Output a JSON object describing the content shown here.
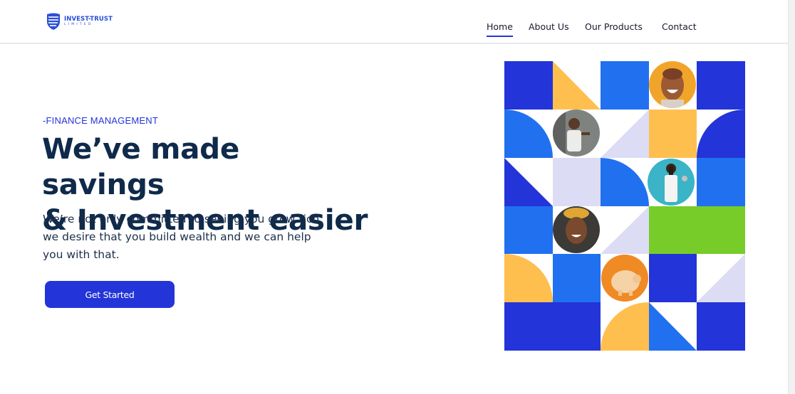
{
  "brand": {
    "name": "INVEST-TRUST",
    "sub": "LIMITED",
    "colors": {
      "primary": "#2334d8",
      "navy": "#0f2a4a"
    },
    "logo_icon": "shield-stripes-icon"
  },
  "nav": {
    "items": [
      {
        "label": "Home",
        "active": true
      },
      {
        "label": "About Us",
        "active": false
      },
      {
        "label": "Our Products",
        "active": false
      },
      {
        "label": "Contact",
        "active": false
      }
    ]
  },
  "hero": {
    "eyebrow": "-FINANCE MANAGEMENT",
    "title_line1": "We’ve made savings",
    "title_line2": "& Investment easier",
    "desc_line1": "We’re not only committed to seeing you grow rich,",
    "desc_line2": "we desire that you build wealth and we can help",
    "desc_line3": "you with that.",
    "cta_label": "Get Started"
  },
  "mosaic": {
    "palette": {
      "blue": "#2334d8",
      "sky": "#2170f0",
      "yellow": "#ffbf4f",
      "lavender": "#dcdcf4",
      "green": "#77cc2a",
      "orange": "#f08a24"
    },
    "photos": [
      "person-photo-laughing",
      "person-photo-phone",
      "person-photo-apron",
      "person-photo-smiling",
      "piggy-bank-photo"
    ]
  }
}
